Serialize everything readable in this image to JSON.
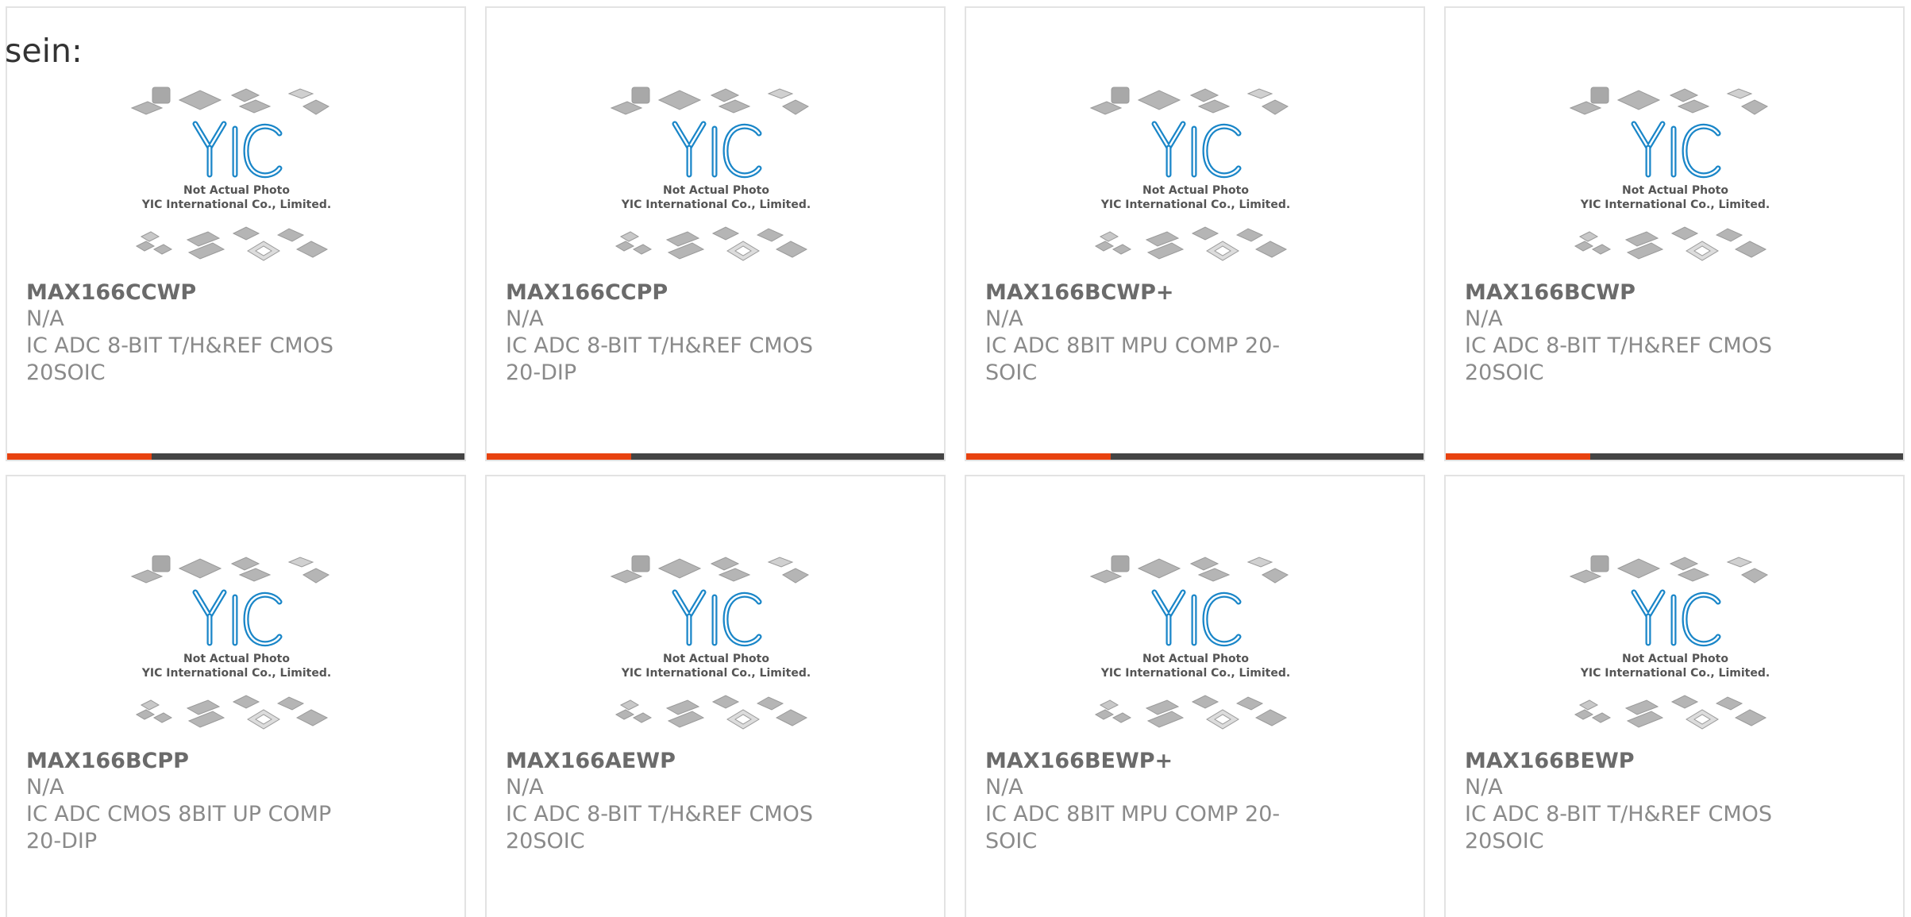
{
  "intro_text": "sein:",
  "colors": {
    "accent": "#e8420f",
    "bar": "#444444",
    "card_border": "#e3e3e3",
    "logo_blue": "#1a86c8",
    "title_text": "#6b6b6b",
    "body_text": "#8a8a8a"
  },
  "placeholder": {
    "logo_text": "YIC",
    "line1": "Not Actual Photo",
    "line2": "YIC International Co., Limited."
  },
  "products": [
    {
      "part": "MAX166CCWP",
      "manufacturer": "N/A",
      "description": "IC ADC 8-BIT T/H&REF CMOS 20SOIC",
      "accent_bar": true
    },
    {
      "part": "MAX166CCPP",
      "manufacturer": "N/A",
      "description": "IC ADC 8-BIT T/H&REF CMOS 20-DIP",
      "accent_bar": true
    },
    {
      "part": "MAX166BCWP+",
      "manufacturer": "N/A",
      "description": "IC ADC 8BIT MPU COMP 20-SOIC",
      "accent_bar": true
    },
    {
      "part": "MAX166BCWP",
      "manufacturer": "N/A",
      "description": "IC ADC 8-BIT T/H&REF CMOS 20SOIC",
      "accent_bar": true
    },
    {
      "part": "MAX166BCPP",
      "manufacturer": "N/A",
      "description": "IC ADC CMOS 8BIT UP COMP 20-DIP",
      "accent_bar": false
    },
    {
      "part": "MAX166AEWP",
      "manufacturer": "N/A",
      "description": "IC ADC 8-BIT T/H&REF CMOS 20SOIC",
      "accent_bar": false
    },
    {
      "part": "MAX166BEWP+",
      "manufacturer": "N/A",
      "description": "IC ADC 8BIT MPU COMP 20-SOIC",
      "accent_bar": false
    },
    {
      "part": "MAX166BEWP",
      "manufacturer": "N/A",
      "description": "IC ADC 8-BIT T/H&REF CMOS 20SOIC",
      "accent_bar": false
    }
  ]
}
